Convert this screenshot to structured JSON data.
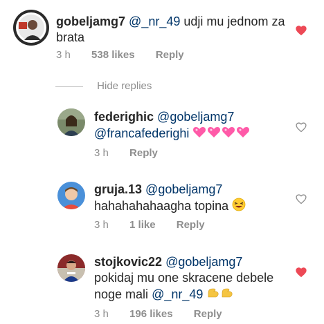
{
  "comments": [
    {
      "username": "gobeljamg7",
      "mention": "@_nr_49",
      "text_line1": "udji mu jednom za",
      "text_line2": "brata",
      "time": "3 h",
      "likes": "538 likes",
      "reply": "Reply",
      "liked": true
    },
    {
      "username": "federighic",
      "mention": "@gobeljamg7",
      "mention2": "@francafederighi",
      "emoji": "four pink sparkling heart emojis",
      "time": "3 h",
      "reply": "Reply",
      "liked": false
    },
    {
      "username": "gruja.13",
      "mention": "@gobeljamg7",
      "text": "hahahahahaagha topina",
      "emoji": "laughing face emoji",
      "time": "3 h",
      "likes": "1 like",
      "reply": "Reply",
      "liked": false
    },
    {
      "username": "stojkovic22",
      "mention": "@gobeljamg7",
      "text_line1": "pokidaj mu one skracene debele",
      "text_line2_prefix": "noge mali",
      "mention2": "@_nr_49",
      "emoji": "two flexed biceps emojis",
      "time": "3 h",
      "likes": "196 likes",
      "reply": "Reply",
      "liked": true
    }
  ],
  "hide_replies_label": "Hide replies",
  "colors": {
    "heart_liked": "#ed4956",
    "heart_outline": "#8e8e8e",
    "mention": "#003569",
    "meta": "#8e8e8e"
  }
}
